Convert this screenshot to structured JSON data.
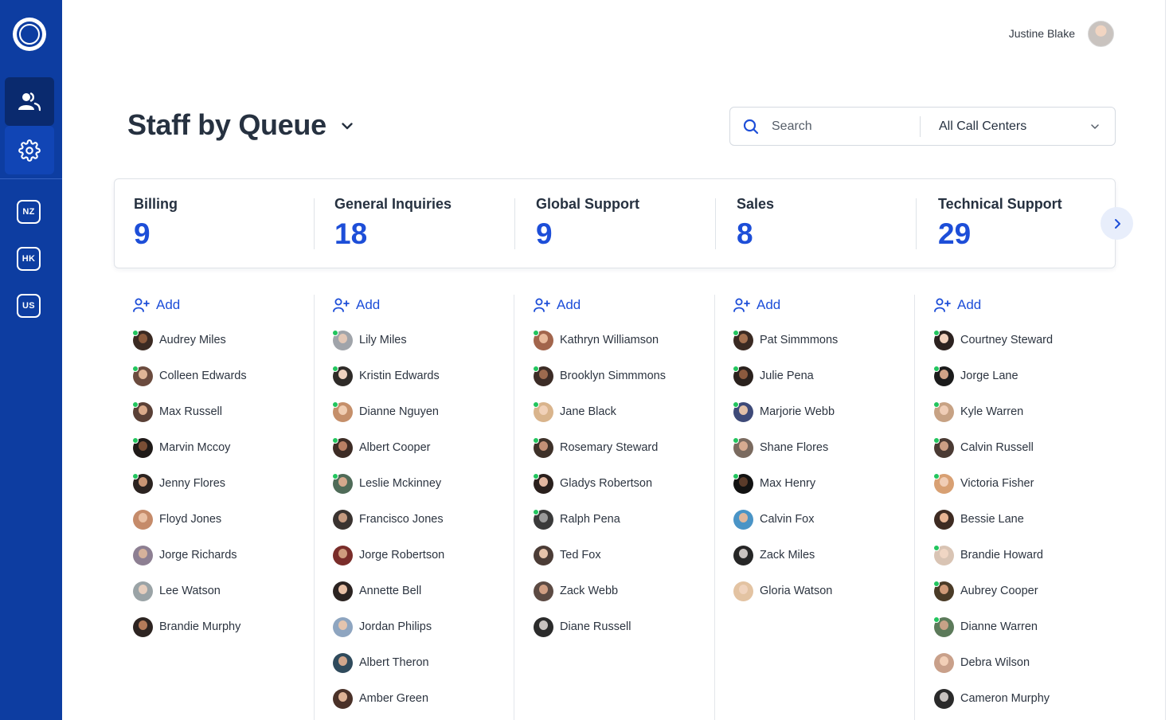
{
  "sidebar": {
    "regions": [
      "NZ",
      "HK",
      "US"
    ]
  },
  "user": {
    "name": "Justine Blake"
  },
  "page": {
    "title": "Staff by Queue"
  },
  "search": {
    "placeholder": "Search",
    "call_center": "All Call Centers"
  },
  "queues": [
    {
      "name": "Billing",
      "count": "9"
    },
    {
      "name": "General Inquiries",
      "count": "18"
    },
    {
      "name": "Global Support",
      "count": "9"
    },
    {
      "name": "Sales",
      "count": "8"
    },
    {
      "name": "Technical Support",
      "count": "29"
    }
  ],
  "add_label": "Add",
  "columns": [
    [
      {
        "name": "Audrey Miles",
        "online": true,
        "skin": "#8b5a3c",
        "bg": "#3b2a22"
      },
      {
        "name": "Colleen Edwards",
        "online": true,
        "skin": "#e0b596",
        "bg": "#6b4b3e"
      },
      {
        "name": "Max Russell",
        "online": true,
        "skin": "#d9a98a",
        "bg": "#5a4036"
      },
      {
        "name": "Marvin Mccoy",
        "online": true,
        "skin": "#7a4e35",
        "bg": "#1f1a18"
      },
      {
        "name": "Jenny Flores",
        "online": true,
        "skin": "#c99574",
        "bg": "#2b2320"
      },
      {
        "name": "Floyd Jones",
        "online": false,
        "skin": "#e9c0a4",
        "bg": "#c58b6a"
      },
      {
        "name": "Jorge Richards",
        "online": false,
        "skin": "#d6b29b",
        "bg": "#8d7f92"
      },
      {
        "name": "Lee Watson",
        "online": false,
        "skin": "#e5cdbd",
        "bg": "#9aa3a6"
      },
      {
        "name": "Brandie Murphy",
        "online": false,
        "skin": "#b47b5a",
        "bg": "#2d2421"
      }
    ],
    [
      {
        "name": "Lily Miles",
        "online": true,
        "skin": "#e2c7b6",
        "bg": "#a0a4aa"
      },
      {
        "name": "Kristin Edwards",
        "online": true,
        "skin": "#efd2bf",
        "bg": "#2f2b28"
      },
      {
        "name": "Dianne Nguyen",
        "online": true,
        "skin": "#f0cdb2",
        "bg": "#c58f6a"
      },
      {
        "name": "Albert Cooper",
        "online": true,
        "skin": "#b98064",
        "bg": "#3d2c25"
      },
      {
        "name": "Leslie Mckinney",
        "online": true,
        "skin": "#d4a88c",
        "bg": "#4f6b58"
      },
      {
        "name": "Francisco Jones",
        "online": false,
        "skin": "#c59a80",
        "bg": "#3a3330"
      },
      {
        "name": "Jorge Robertson",
        "online": false,
        "skin": "#cf9c7e",
        "bg": "#7a2d2a"
      },
      {
        "name": "Annette Bell",
        "online": false,
        "skin": "#e8c0a6",
        "bg": "#2b2321"
      },
      {
        "name": "Jordan Philips",
        "online": false,
        "skin": "#e4c4ae",
        "bg": "#8ea5c0"
      },
      {
        "name": "Albert Theron",
        "online": false,
        "skin": "#d1a68c",
        "bg": "#2f4a5c"
      },
      {
        "name": "Amber Green",
        "online": false,
        "skin": "#ddb295",
        "bg": "#4a3128"
      }
    ],
    [
      {
        "name": "Kathryn Williamson",
        "online": true,
        "skin": "#e8b99a",
        "bg": "#a2654c"
      },
      {
        "name": "Brooklyn Simmmons",
        "online": true,
        "skin": "#9c6a4e",
        "bg": "#3c2c26"
      },
      {
        "name": "Jane Black",
        "online": true,
        "skin": "#f1d1b8",
        "bg": "#d9b48c"
      },
      {
        "name": "Rosemary Steward",
        "online": true,
        "skin": "#c39076",
        "bg": "#3e3129"
      },
      {
        "name": "Gladys Robertson",
        "online": true,
        "skin": "#e3b7a0",
        "bg": "#2a201d"
      },
      {
        "name": "Ralph Pena",
        "online": true,
        "skin": "#9a9a9a",
        "bg": "#3a3a3a"
      },
      {
        "name": "Ted Fox",
        "online": false,
        "skin": "#e6c3aa",
        "bg": "#4b3c36"
      },
      {
        "name": "Zack Webb",
        "online": false,
        "skin": "#d09e83",
        "bg": "#5c4a43"
      },
      {
        "name": "Diane Russell",
        "online": false,
        "skin": "#c9c3c0",
        "bg": "#2b2b2b"
      }
    ],
    [
      {
        "name": "Pat Simmmons",
        "online": true,
        "skin": "#a3704f",
        "bg": "#3a2a22"
      },
      {
        "name": "Julie Pena",
        "online": true,
        "skin": "#8b5a3e",
        "bg": "#2a211d"
      },
      {
        "name": "Marjorie Webb",
        "online": true,
        "skin": "#e2c0a8",
        "bg": "#3e4a78"
      },
      {
        "name": "Shane Flores",
        "online": true,
        "skin": "#d6ab90",
        "bg": "#7a6a5f"
      },
      {
        "name": "Max Henry",
        "online": true,
        "skin": "#5a3b2a",
        "bg": "#121212"
      },
      {
        "name": "Calvin Fox",
        "online": false,
        "skin": "#e0b79c",
        "bg": "#4a94c6"
      },
      {
        "name": "Zack Miles",
        "online": false,
        "skin": "#c9c3c0",
        "bg": "#262626"
      },
      {
        "name": "Gloria Watson",
        "online": false,
        "skin": "#f0d3bd",
        "bg": "#e3c3a2"
      }
    ],
    [
      {
        "name": "Courtney Steward",
        "online": true,
        "skin": "#f0d0bc",
        "bg": "#2c2220"
      },
      {
        "name": "Jorge Lane",
        "online": true,
        "skin": "#d0a286",
        "bg": "#1b1b1b"
      },
      {
        "name": "Kyle Warren",
        "online": true,
        "skin": "#efcdb6",
        "bg": "#c7a284"
      },
      {
        "name": "Calvin Russell",
        "online": true,
        "skin": "#cc9f84",
        "bg": "#4a3a33"
      },
      {
        "name": "Victoria Fisher",
        "online": true,
        "skin": "#f1cdb5",
        "bg": "#d8a073"
      },
      {
        "name": "Bessie Lane",
        "online": false,
        "skin": "#e8b594",
        "bg": "#3e2b22"
      },
      {
        "name": "Brandie Howard",
        "online": true,
        "skin": "#f0d6c4",
        "bg": "#d9c4b4"
      },
      {
        "name": "Aubrey Cooper",
        "online": true,
        "skin": "#cf9a78",
        "bg": "#4a3b27"
      },
      {
        "name": "Dianne Warren",
        "online": true,
        "skin": "#c7a287",
        "bg": "#5c7a5a"
      },
      {
        "name": "Debra Wilson",
        "online": false,
        "skin": "#f2cfb7",
        "bg": "#c9a08a"
      },
      {
        "name": "Cameron Murphy",
        "online": false,
        "skin": "#c7c2bf",
        "bg": "#2a2a2a"
      }
    ]
  ],
  "colors": {
    "sidebar": "#0d3da1",
    "accent": "#1d4ed8",
    "online": "#22c55e"
  }
}
